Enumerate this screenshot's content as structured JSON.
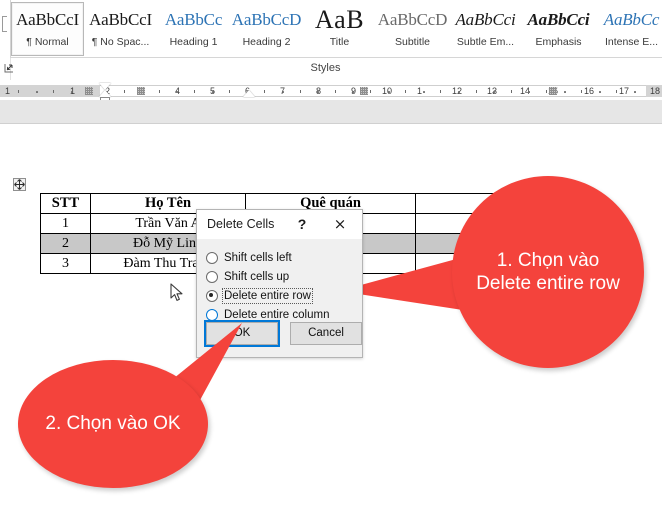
{
  "ribbon": {
    "group_label": "Styles",
    "launcher_icon": "dialog-launcher-icon",
    "styles": [
      {
        "preview": "AaBbCcI",
        "label": "¶ Normal",
        "variant": "serif",
        "selected": true
      },
      {
        "preview": "AaBbCcI",
        "label": "¶ No Spac...",
        "variant": "serif",
        "selected": false
      },
      {
        "preview": "AaBbCc",
        "label": "Heading 1",
        "variant": "blue",
        "selected": false
      },
      {
        "preview": "AaBbCcD",
        "label": "Heading 2",
        "variant": "blue",
        "selected": false
      },
      {
        "preview": "AaB",
        "label": "Title",
        "variant": "big",
        "selected": false
      },
      {
        "preview": "AaBbCcD",
        "label": "Subtitle",
        "variant": "gray",
        "selected": false
      },
      {
        "preview": "AaBbCci",
        "label": "Subtle Em...",
        "variant": "italic",
        "selected": false
      },
      {
        "preview": "AaBbCci",
        "label": "Emphasis",
        "variant": "bolditalic",
        "selected": false
      },
      {
        "preview": "AaBbCc",
        "label": "Intense E...",
        "variant": "blue-italic",
        "selected": false
      }
    ]
  },
  "ruler": {
    "marks": [
      "1",
      "1",
      "2",
      "3",
      "4",
      "5",
      "6",
      "7",
      "8",
      "9",
      "10",
      "1",
      "12",
      "13",
      "14",
      "15",
      "16",
      "17",
      "18"
    ]
  },
  "document": {
    "table": {
      "headers": [
        "STT",
        "Họ Tên",
        "Quê quán",
        ""
      ],
      "rows": [
        {
          "cells": [
            "1",
            "Trần Văn A",
            "",
            ""
          ],
          "selected": false
        },
        {
          "cells": [
            "2",
            "Đỗ Mỹ Linh",
            "",
            ""
          ],
          "selected": true
        },
        {
          "cells": [
            "3",
            "Đàm Thu Trang",
            "",
            ""
          ],
          "selected": false
        }
      ]
    },
    "move_handle_icon": "move-cross-icon",
    "resize_handle_icon": "resize-handle-icon",
    "cursor_icon": "mouse-pointer-icon"
  },
  "dialog": {
    "title": "Delete Cells",
    "help_icon": "?",
    "close_icon": "×",
    "options": [
      {
        "label": "Shift cells left",
        "underline": "l",
        "checked": false,
        "focused": false,
        "accent": "gray"
      },
      {
        "label": "Shift cells up",
        "underline": "u",
        "checked": false,
        "focused": false,
        "accent": "gray"
      },
      {
        "label": "Delete entire row",
        "underline": "r",
        "checked": true,
        "focused": true,
        "accent": "gray"
      },
      {
        "label": "Delete entire column",
        "underline": "c",
        "checked": false,
        "focused": false,
        "accent": "blue"
      }
    ],
    "ok_label": "OK",
    "cancel_label": "Cancel"
  },
  "callouts": [
    {
      "id": "callout-1",
      "text": "1. Chọn vào Delete entire row"
    },
    {
      "id": "callout-2",
      "text": "2. Chọn vào OK"
    }
  ],
  "colors": {
    "callout_red": "#f4433c",
    "focus_blue": "#0078d7",
    "selection_gray": "#c8c8c8",
    "heading_blue": "#2e74b5"
  }
}
